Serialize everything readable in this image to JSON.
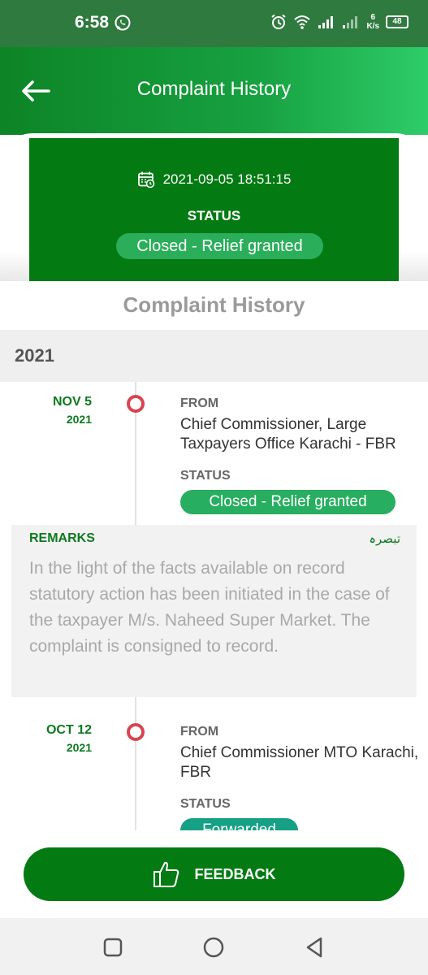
{
  "status_bar": {
    "time": "6:58",
    "net_speed_value": "6",
    "net_speed_unit": "K/s",
    "battery": "48",
    "icons": [
      "whatsapp-icon",
      "alarm-icon",
      "wifi-icon",
      "signal-icon",
      "signal-icon-2",
      "battery-icon"
    ]
  },
  "header": {
    "title": "Complaint History",
    "back_icon": "arrow-left-icon"
  },
  "summary": {
    "datetime": "2021-09-05 18:51:15",
    "status_label": "STATUS",
    "status_value": "Closed - Relief granted"
  },
  "history": {
    "title": "Complaint History",
    "year": "2021",
    "entries": [
      {
        "date": "NOV 5",
        "year": "2021",
        "from_label": "FROM",
        "from": "Chief Commissioner, Large Taxpayers Office Karachi - FBR",
        "status_label": "STATUS",
        "status": "Closed - Relief granted",
        "status_color": "#27ae60"
      },
      {
        "date": "OCT 12",
        "year": "2021",
        "from_label": "FROM",
        "from": "Chief Commissioner MTO Karachi, FBR",
        "status_label": "STATUS",
        "status": "Forwarded",
        "status_color": "#16a085"
      }
    ],
    "remarks": {
      "label": "REMARKS",
      "label_urdu": "تبصرہ",
      "text": "In the light of the facts available on record statutory action has been initiated in the case of the taxpayer M/s. Naheed Super Market. The complaint is consigned to record."
    }
  },
  "feedback": {
    "label": "FEEDBACK",
    "icon": "thumbs-up-icon"
  },
  "colors": {
    "primary": "#047a13",
    "accent": "#2aae5a",
    "dot": "#d64550"
  },
  "nav": {
    "icons": [
      "recent-apps-icon",
      "home-icon",
      "back-icon"
    ]
  }
}
